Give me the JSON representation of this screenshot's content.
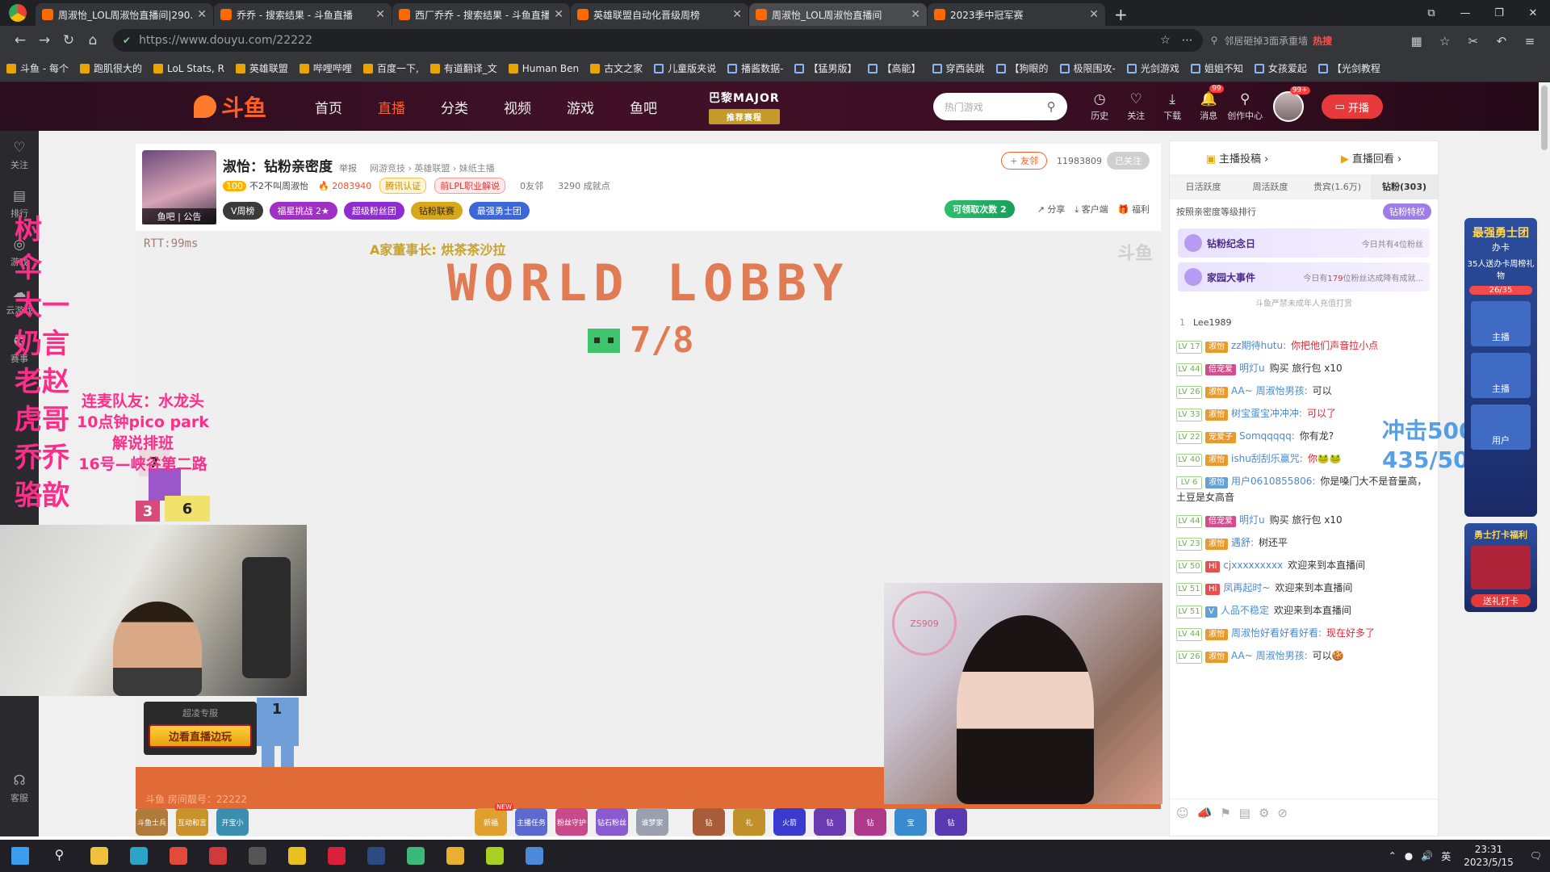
{
  "browser": {
    "tabs": [
      {
        "label": "周淑怡_LOL周淑怡直播间|290..."
      },
      {
        "label": "乔乔 - 搜索结果 - 斗鱼直播"
      },
      {
        "label": "西厂乔乔 - 搜索结果 - 斗鱼直播"
      },
      {
        "label": "英雄联盟自动化晋级周榜"
      },
      {
        "label": "周淑怡_LOL周淑怡直播间"
      },
      {
        "label": "2023季中冠军赛"
      }
    ],
    "url": "https://www.douyu.com/22222",
    "search_placeholder": "邻居砸掉3面承重墙",
    "search_hot": "热搜",
    "bookmarks": [
      {
        "label": "斗鱼 - 每个"
      },
      {
        "label": "跑肌很大的"
      },
      {
        "label": "LoL Stats, R"
      },
      {
        "label": "英雄联盟"
      },
      {
        "label": "哔哩哔哩"
      },
      {
        "label": "百度一下,"
      },
      {
        "label": "有道翻译_文"
      },
      {
        "label": "Human Ben"
      },
      {
        "label": "古文之家"
      },
      {
        "label": "儿童版夹说"
      },
      {
        "label": "播酱数据-"
      },
      {
        "label": "【猛男版】"
      },
      {
        "label": "【高能】"
      },
      {
        "label": "穿西装跳"
      },
      {
        "label": "【狗眼的"
      },
      {
        "label": "极限围攻-"
      },
      {
        "label": "光剑游戏"
      },
      {
        "label": "姐姐不知"
      },
      {
        "label": "女孩爱起"
      },
      {
        "label": "【光剑教程"
      }
    ]
  },
  "header": {
    "logo": "斗鱼",
    "nav": [
      "首页",
      "直播",
      "分类",
      "视频",
      "游戏",
      "鱼吧"
    ],
    "active_nav": "直播",
    "major_title": "巴黎MAJOR",
    "major_sub": "推荐赛程",
    "search_placeholder": "热门游戏",
    "icons": [
      {
        "label": "历史",
        "glyph": "◷"
      },
      {
        "label": "关注",
        "glyph": "♡"
      },
      {
        "label": "下载",
        "glyph": "⤓"
      },
      {
        "label": "消息",
        "glyph": "🔔",
        "badge": "99"
      },
      {
        "label": "创作中心",
        "glyph": "⚲"
      }
    ],
    "avatar_badge": "99+",
    "start_live": "开播"
  },
  "sidebar": {
    "items": [
      {
        "label": "关注",
        "glyph": "♡"
      },
      {
        "label": "排行",
        "glyph": "▤"
      },
      {
        "label": "游戏",
        "glyph": "◎"
      },
      {
        "label": "云游戏",
        "glyph": "☁"
      },
      {
        "label": "赛事",
        "glyph": "✪"
      }
    ],
    "service": "客服"
  },
  "room": {
    "avatar_caption": "鱼吧 | 公告",
    "title": "淑怡：钻粉亲密度",
    "report": "举报",
    "breadcrumb": "网游竞技 › 英雄联盟 › 妹纸主播",
    "level": "100",
    "owner": "不2不叫周淑怡",
    "hot": "2083940",
    "tag_tencent": "腾讯认证",
    "tag_lpl": "前LPL职业解说",
    "friends": "0友邻",
    "achievements": "3290 成就点",
    "badges": [
      "V周榜",
      "福星挑战 2★",
      "超级粉丝团",
      "钻粉联赛",
      "最强勇士团"
    ],
    "friend_btn": "+ 友邻",
    "room_number": "11983809",
    "follow": "已关注",
    "claim": "可领取次数 2",
    "actions": [
      "分享",
      "客户端",
      "福利"
    ]
  },
  "video": {
    "rtt": "RTT:99ms",
    "captain": "A家董事长: 烘茶茶沙拉",
    "world_lobby": "WORLD LOBBY",
    "lobby_count": "7/8",
    "watermark": "斗鱼",
    "room_id_text": "斗鱼 房间靓号：22222",
    "watch_play_label": "超凌专服",
    "watch_play_btn": "边看直播边玩",
    "players": [
      "7",
      "3",
      "6",
      "5",
      "1"
    ],
    "face_logo": "ZS909"
  },
  "overlay": {
    "names": [
      "树",
      "伞",
      "太一",
      "奶言",
      "老赵",
      "虎哥",
      "乔乔",
      "骆歆"
    ],
    "notes": [
      "连麦队友：水龙头",
      "10点钟pico park",
      "解说排班",
      "16号—峡谷第二路"
    ]
  },
  "gifts": [
    {
      "label": "斗鱼士兵",
      "color": "#b07a3a"
    },
    {
      "label": "互动和言",
      "color": "#c8932a"
    },
    {
      "label": "开宝小",
      "color": "#3a8fb0"
    },
    {
      "label": "新福",
      "color": "#e0a030",
      "new": "NEW"
    },
    {
      "label": "主播任务",
      "color": "#5a6ad0"
    },
    {
      "label": "粉丝守护",
      "color": "#c94a8a"
    },
    {
      "label": "钻石粉丝",
      "color": "#8a5ad0"
    },
    {
      "label": "谁梦家",
      "color": "#9aa0b0"
    },
    {
      "label": "钻",
      "color": "#a85c3a"
    },
    {
      "label": "礼",
      "color": "#c0902a"
    },
    {
      "label": "火箭",
      "color": "#3a3ad0"
    },
    {
      "label": "钻",
      "color": "#6a3ab0"
    },
    {
      "label": "钻",
      "color": "#b03a8a"
    },
    {
      "label": "宝",
      "color": "#3a8ad0"
    },
    {
      "label": "钻",
      "color": "#5a3ab0"
    }
  ],
  "chat": {
    "top_links": [
      "主播投稿 ›",
      "直播回看 ›"
    ],
    "tabs": [
      "日活跃度",
      "周活跃度",
      "贵宾(1.6万)",
      "钻粉(303)"
    ],
    "active_tab": "钻粉(303)",
    "rank_desc": "按照亲密度等级排行",
    "privilege": "钻粉特权",
    "banner1_title": "钻粉纪念日",
    "banner1_sub": "今日共有4位粉丝",
    "banner2_title": "家园大事件",
    "banner2_sub_pre": "今日有",
    "banner2_sub_num": "179",
    "banner2_sub_post": "位粉丝达成降有成就...",
    "notice": "斗鱼严禁未成年人充值打赏",
    "top_user_rank": "1",
    "top_user_name": "Lee1989",
    "messages": [
      {
        "lv": "LV 17",
        "fan": "淑怡",
        "fan_class": "",
        "user": "zz期待hutu:",
        "text": "你把他们声音拉小点",
        "text_class": "red"
      },
      {
        "lv": "LV 44",
        "fan": "倍宠爱",
        "fan_class": "purple",
        "user": "明灯u",
        "text": "购买 旅行包 x10",
        "text_class": ""
      },
      {
        "lv": "LV 26",
        "fan": "淑怡",
        "fan_class": "",
        "user": "AA~ 周淑怡男孩:",
        "text": "可以",
        "text_class": ""
      },
      {
        "lv": "LV 33",
        "fan": "淑怡",
        "fan_class": "",
        "user": "树宝蛋宝冲冲冲:",
        "text": "可以了",
        "text_class": "red"
      },
      {
        "lv": "LV 22",
        "fan": "宠爱子",
        "fan_class": "",
        "user": "Somqqqqq:",
        "text": "你有龙?",
        "text_class": ""
      },
      {
        "lv": "LV 40",
        "fan": "淑怡",
        "fan_class": "",
        "user": "ishu刮刮乐赢咒:",
        "text": "你🐸🐸",
        "text_class": "red"
      },
      {
        "lv": "LV 6",
        "fan": "淑怡",
        "fan_class": "blue",
        "user": "用户0610855806:",
        "text": "你是嗓门大不是音量高，土豆是女高音",
        "text_class": ""
      },
      {
        "lv": "LV 44",
        "fan": "倍宠爱",
        "fan_class": "purple",
        "user": "明灯u",
        "text": "购买 旅行包 x10",
        "text_class": ""
      },
      {
        "lv": "LV 23",
        "fan": "淑怡",
        "fan_class": "",
        "user": "遇舒:",
        "text": "树还平",
        "text_class": ""
      },
      {
        "lv": "LV 50",
        "fan": "Hi",
        "fan_class": "hi",
        "user": "cjxxxxxxxxx",
        "text": "欢迎来到本直播间",
        "text_class": ""
      },
      {
        "lv": "LV 51",
        "fan": "Hi",
        "fan_class": "hi",
        "user": "凤再起时~",
        "text": "欢迎来到本直播间",
        "text_class": ""
      },
      {
        "lv": "LV 51",
        "fan": "V",
        "fan_class": "blue",
        "user": "人品不稳定",
        "text": "欢迎来到本直播间",
        "text_class": ""
      },
      {
        "lv": "LV 44",
        "fan": "淑怡",
        "fan_class": "",
        "user": "周淑怡好看好看好看:",
        "text": "现在好多了",
        "text_class": "red"
      },
      {
        "lv": "LV 26",
        "fan": "淑怡",
        "fan_class": "",
        "user": "AA~ 周淑怡男孩:",
        "text": "可以🍪",
        "text_class": ""
      }
    ]
  },
  "float_score": {
    "line1": "冲击500钻粉!",
    "line2": "435/500"
  },
  "right_col": {
    "title": "最强勇士团",
    "sub": "办卡",
    "desc": "35人送办卡周榜礼物",
    "progress": "26/35",
    "items": [
      "主播",
      "主播",
      "用户"
    ],
    "card2_title": "勇士打卡福利",
    "card2_btn": "送礼打卡"
  },
  "taskbar": {
    "apps": [
      {
        "name": "windows-start",
        "color": "#3b9cf0"
      },
      {
        "name": "search",
        "color": "#888888"
      },
      {
        "name": "file-explorer",
        "color": "#f0c23b"
      },
      {
        "name": "edge",
        "color": "#2aa5c8"
      },
      {
        "name": "chrome",
        "color": "#e24a3a"
      },
      {
        "name": "app-red",
        "color": "#d03a3a"
      },
      {
        "name": "app-black",
        "color": "#555555"
      },
      {
        "name": "app-yellow",
        "color": "#e8c020"
      },
      {
        "name": "netease-music",
        "color": "#d8203a"
      },
      {
        "name": "steam",
        "color": "#2a4a80"
      },
      {
        "name": "app-green",
        "color": "#3cb878"
      },
      {
        "name": "app-wegame",
        "color": "#e8b030"
      },
      {
        "name": "app-lime",
        "color": "#a8d020"
      },
      {
        "name": "app-blue",
        "color": "#4a8ad8"
      }
    ],
    "ime": "英",
    "time": "23:31",
    "date": "2023/5/15"
  }
}
